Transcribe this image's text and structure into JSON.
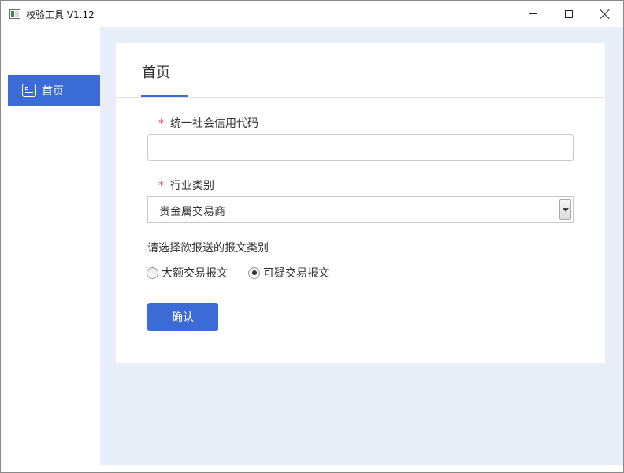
{
  "window": {
    "title": "校验工具 V1.12",
    "controls": {
      "minimize": "minimize",
      "maximize": "maximize",
      "close": "close"
    }
  },
  "sidebar": {
    "items": [
      {
        "label": "首页",
        "icon": "id-card-icon",
        "active": true
      }
    ]
  },
  "main": {
    "tab_title": "首页",
    "form": {
      "code_field": {
        "label": "统一社会信用代码",
        "value": "",
        "placeholder": "",
        "required_mark": "*"
      },
      "industry_field": {
        "label": "行业类别",
        "selected": "贵金属交易商",
        "required_mark": "*"
      },
      "report_type_prompt": "请选择欲报送的报文类别",
      "report_types": [
        {
          "label": "大额交易报文",
          "checked": false
        },
        {
          "label": "可疑交易报文",
          "checked": true
        }
      ],
      "confirm_label": "确认"
    }
  },
  "colors": {
    "accent": "#3b6bd6",
    "content_background": "#e8eef8",
    "required": "#e05050"
  }
}
